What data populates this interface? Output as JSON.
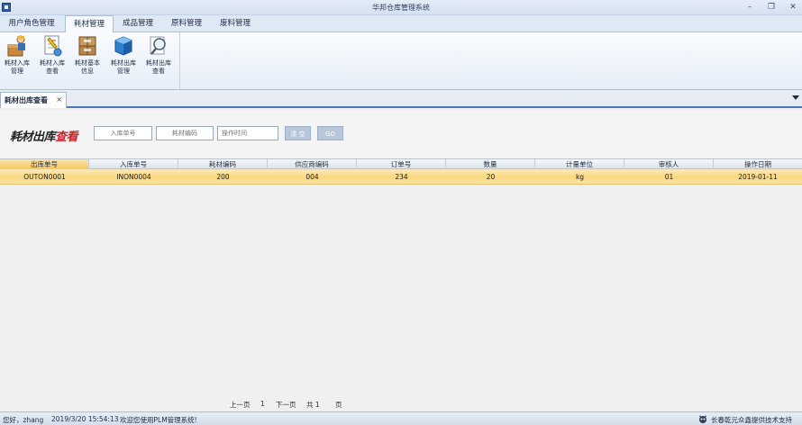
{
  "window": {
    "title": "华邦仓库管理系统"
  },
  "menu": {
    "tabs": [
      {
        "label": "用户角色管理"
      },
      {
        "label": "耗材管理"
      },
      {
        "label": "成品管理"
      },
      {
        "label": "原料管理"
      },
      {
        "label": "废料管理"
      }
    ],
    "active_index": 1
  },
  "ribbon": {
    "buttons": [
      {
        "line1": "耗材入库",
        "line2": "管理",
        "icon": "worker-box-icon"
      },
      {
        "line1": "耗材入库",
        "line2": "查看",
        "icon": "document-view-icon"
      },
      {
        "line1": "耗材基本",
        "line2": "信息",
        "icon": "package-boxes-icon"
      },
      {
        "line1": "耗材出库",
        "line2": "管理",
        "icon": "blue-cube-icon"
      },
      {
        "line1": "耗材出库",
        "line2": "查看",
        "icon": "magnifier-icon"
      }
    ]
  },
  "doc_tab": {
    "label": "耗材出库查看",
    "close": "×"
  },
  "search": {
    "title_dark": "耗材出库",
    "title_red": "查看",
    "inbound_placeholder": "入库单号",
    "material_placeholder": "耗材编码",
    "time_placeholder": "操作时间",
    "clear_label": "清 空",
    "go_label": "GO"
  },
  "grid": {
    "columns": [
      "出库单号",
      "入库单号",
      "耗材编码",
      "供应商编码",
      "订单号",
      "数量",
      "计量单位",
      "审核人",
      "操作日期"
    ],
    "rows": [
      [
        "OUTON0001",
        "INON0004",
        "200",
        "004",
        "234",
        "20",
        "kg",
        "01",
        "2019-01-11"
      ]
    ]
  },
  "pager": {
    "prev": "上一页",
    "current": "1",
    "next": "下一页",
    "total_prefix": "共 1",
    "total_suffix": "页"
  },
  "status": {
    "greeting": "您好，zhang",
    "datetime": "2019/3/20 15:54:13",
    "welcome": "欢迎您使用PLM管理系统!",
    "support": "长春乾元众鑫提供技术支持"
  },
  "colors": {
    "accent": "#4a76b8",
    "selected_row": "#f9d77d",
    "title_red": "#c8242b"
  }
}
